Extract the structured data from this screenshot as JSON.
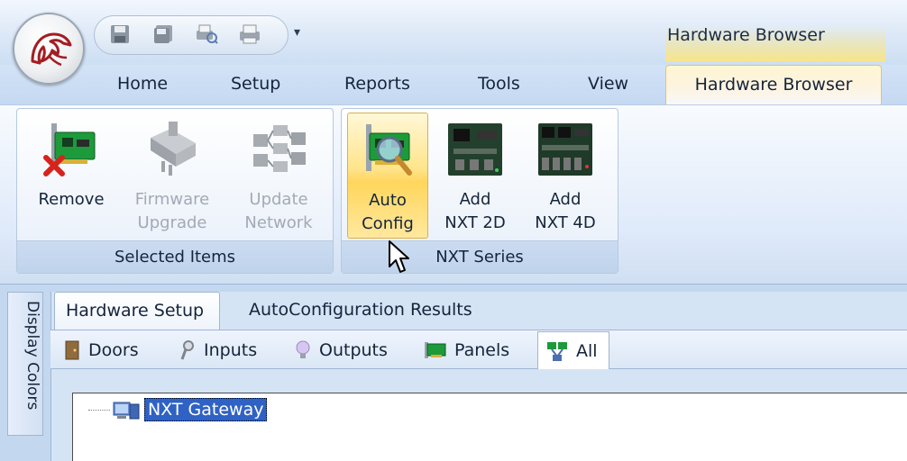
{
  "window": {
    "title": "Hardware Browser"
  },
  "quick_access": {
    "items": [
      "save-icon",
      "save-all-icon",
      "print-preview-icon",
      "print-icon"
    ],
    "more": "▾"
  },
  "ribbon": {
    "tabs": [
      "Home",
      "Setup",
      "Reports",
      "Tools",
      "View",
      "Hardware Browser"
    ],
    "active_tab": "Hardware Browser",
    "groups": [
      {
        "label": "Selected Items",
        "buttons": [
          {
            "label": "Remove",
            "icon": "remove-card-icon",
            "enabled": true
          },
          {
            "label": "Firmware\nUpgrade",
            "icon": "firmware-upgrade-icon",
            "enabled": false
          },
          {
            "label": "Update\nNetwork",
            "icon": "update-network-icon",
            "enabled": false
          }
        ]
      },
      {
        "label": "NXT Series",
        "buttons": [
          {
            "label": "Auto\nConfig",
            "icon": "auto-config-icon",
            "enabled": true,
            "hovered": true
          },
          {
            "label": "Add\nNXT 2D",
            "icon": "nxt-2d-board-icon",
            "enabled": true
          },
          {
            "label": "Add\nNXT 4D",
            "icon": "nxt-4d-board-icon",
            "enabled": true
          }
        ]
      }
    ]
  },
  "side_panel": {
    "label": "Display Colors"
  },
  "document_tabs": {
    "items": [
      "Hardware Setup",
      "AutoConfiguration Results"
    ],
    "active": "Hardware Setup"
  },
  "filter_tabs": {
    "items": [
      {
        "label": "Doors",
        "icon": "door-icon"
      },
      {
        "label": "Inputs",
        "icon": "input-icon"
      },
      {
        "label": "Outputs",
        "icon": "bulb-icon"
      },
      {
        "label": "Panels",
        "icon": "panel-icon"
      },
      {
        "label": "All",
        "icon": "network-icon"
      }
    ],
    "active": "All"
  },
  "tree": {
    "items": [
      {
        "label": "NXT Gateway",
        "icon": "gateway-icon",
        "selected": true
      }
    ]
  },
  "colors": {
    "accent_hover": "#ffd65c",
    "selection": "#2f62c4",
    "ribbon_bg": "#dfeafa"
  }
}
